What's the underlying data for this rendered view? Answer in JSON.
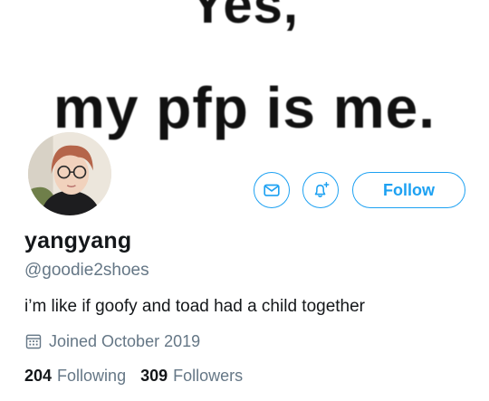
{
  "banner": {
    "line1": "Yes,",
    "line2": "my pfp is me."
  },
  "actions": {
    "follow_label": "Follow",
    "mail_icon": "mail-icon",
    "bell_icon": "notification-bell-add-icon",
    "accent_color": "#1da1f2"
  },
  "profile": {
    "display_name": "yangyang",
    "handle": "@goodie2shoes",
    "bio": "i’m like if goofy and toad had a child together",
    "joined": "Joined October 2019",
    "joined_icon": "calendar-icon"
  },
  "stats": {
    "following_count": "204",
    "following_label": "Following",
    "followers_count": "309",
    "followers_label": "Followers"
  },
  "colors": {
    "primary_text": "#14171a",
    "secondary_text": "#657786"
  }
}
